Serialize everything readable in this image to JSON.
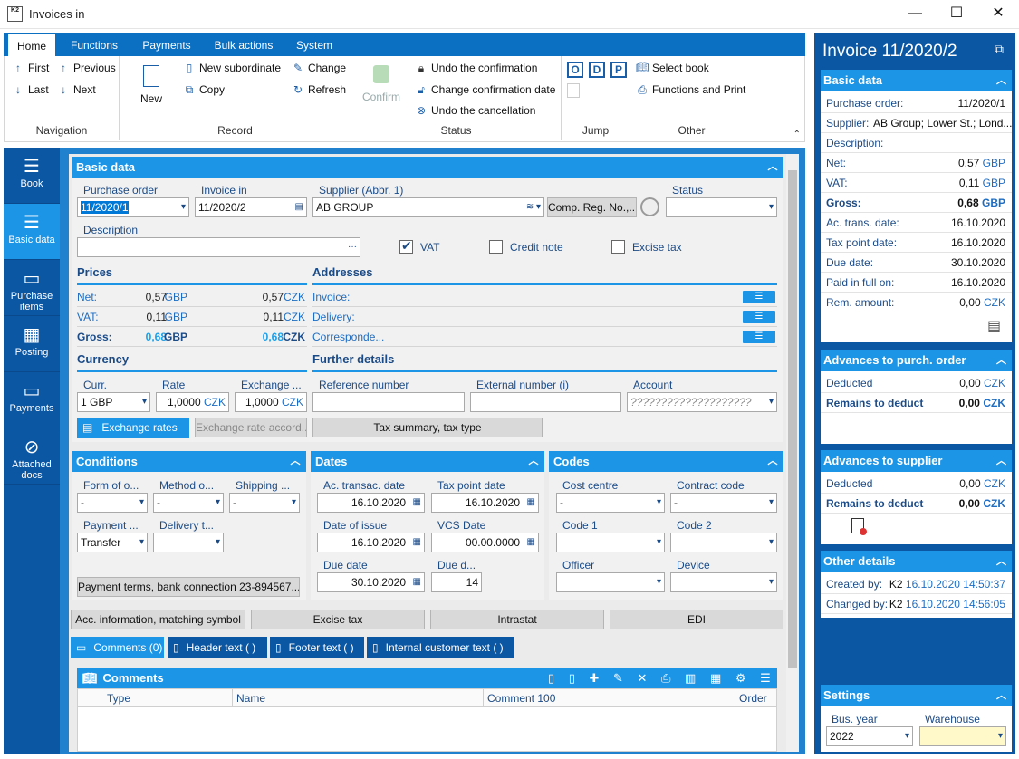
{
  "window": {
    "title": "Invoices in",
    "min": "—",
    "max": "☐",
    "close": "✕"
  },
  "ribbon": {
    "tabs": [
      "Home",
      "Functions",
      "Payments",
      "Bulk actions",
      "System"
    ],
    "nav": {
      "first": "First",
      "previous": "Previous",
      "last": "Last",
      "next": "Next",
      "label": "Navigation"
    },
    "record": {
      "new": "New",
      "new_sub": "New subordinate",
      "change": "Change",
      "copy": "Copy",
      "refresh": "Refresh",
      "label": "Record"
    },
    "status": {
      "confirm": "Confirm",
      "undo_conf": "Undo the confirmation",
      "change_date": "Change confirmation date",
      "undo_cancel": "Undo the cancellation",
      "label": "Status"
    },
    "jump": {
      "o": "O",
      "d": "D",
      "p": "P",
      "label": "Jump"
    },
    "other": {
      "select_book": "Select book",
      "func_print": "Functions and Print",
      "label": "Other"
    }
  },
  "leftnav": [
    {
      "label": "Book",
      "icon": "☰"
    },
    {
      "label": "Basic data",
      "icon": "☰"
    },
    {
      "label": "Purchase items",
      "icon": "▭"
    },
    {
      "label": "Posting",
      "icon": "▦"
    },
    {
      "label": "Payments",
      "icon": "▭"
    },
    {
      "label": "Attached docs",
      "icon": "⊘"
    }
  ],
  "basic": {
    "title": "Basic data",
    "po_label": "Purchase order",
    "po": "11/2020/1",
    "inv_label": "Invoice in",
    "inv": "11/2020/2",
    "sup_label": "Supplier (Abbr. 1)",
    "sup": "AB GROUP",
    "comp_btn": "Comp. Reg. No.,...",
    "status_label": "Status",
    "status": "",
    "desc_label": "Description",
    "desc": "",
    "vat": "VAT",
    "credit": "Credit note",
    "excise": "Excise tax"
  },
  "prices": {
    "title": "Prices",
    "rows": [
      {
        "k": "Net:",
        "a": "0,57",
        "ac": "GBP",
        "b": "0,57",
        "bc": "CZK"
      },
      {
        "k": "VAT:",
        "a": "0,11",
        "ac": "GBP",
        "b": "0,11",
        "bc": "CZK"
      },
      {
        "k": "Gross:",
        "a": "0,68",
        "ac": "GBP",
        "b": "0,68",
        "bc": "CZK"
      }
    ]
  },
  "addresses": {
    "title": "Addresses",
    "rows": [
      "Invoice:",
      "Delivery:",
      "Corresponde..."
    ]
  },
  "currency": {
    "title": "Currency",
    "curr_label": "Curr.",
    "curr": "1 GBP",
    "rate_label": "Rate",
    "rate": "1,0000",
    "rate_c": "CZK",
    "exch_label": "Exchange ...",
    "exch": "1,0000",
    "exch_c": "CZK",
    "btn_rates": "Exchange rates",
    "btn_accord": "Exchange rate accord..."
  },
  "further": {
    "title": "Further details",
    "ref_label": "Reference number",
    "ext_label": "External number (i)",
    "acc_label": "Account",
    "acc": "????????????????????",
    "btn_tax": "Tax summary, tax type"
  },
  "conditions": {
    "title": "Conditions",
    "form_label": "Form of o...",
    "form": "-",
    "method_label": "Method o...",
    "method": "-",
    "ship_label": "Shipping ...",
    "ship": "-",
    "pay_label": "Payment ...",
    "pay": "Transfer",
    "deliv_label": "Delivery t...",
    "deliv": "",
    "terms_btn": "Payment terms, bank connection 23-894567..."
  },
  "dates": {
    "title": "Dates",
    "act_label": "Ac. transac. date",
    "act": "16.10.2020",
    "tax_label": "Tax point date",
    "tax": "16.10.2020",
    "issue_label": "Date of issue",
    "issue": "16.10.2020",
    "vcs_label": "VCS Date",
    "vcs": "00.00.0000",
    "due_label": "Due date",
    "due": "30.10.2020",
    "dued_label": "Due d...",
    "dued": "14"
  },
  "codes": {
    "title": "Codes",
    "cc_label": "Cost centre",
    "cc": "-",
    "contract_label": "Contract code",
    "contract": "-",
    "c1_label": "Code 1",
    "c2_label": "Code 2",
    "officer_label": "Officer",
    "device_label": "Device"
  },
  "bottom_btns": [
    "Acc. information, matching symbol",
    "Excise tax",
    "Intrastat",
    "EDI"
  ],
  "tabs2": [
    "Comments (0)",
    "Header text ( )",
    "Footer text ( )",
    "Internal customer text ( )"
  ],
  "comments": {
    "title": "Comments",
    "cols": [
      "Type",
      "Name",
      "Comment 100",
      "Order"
    ]
  },
  "right": {
    "title": "Invoice 11/2020/2",
    "basic_title": "Basic data",
    "basic": [
      {
        "k": "Purchase order:",
        "v": "11/2020/1",
        "c": ""
      },
      {
        "k": "Supplier:",
        "v": "AB Group; Lower St.; Lond...",
        "c": ""
      },
      {
        "k": "Description:",
        "v": "",
        "c": ""
      },
      {
        "k": "Net:",
        "v": "0,57",
        "c": "GBP"
      },
      {
        "k": "VAT:",
        "v": "0,11",
        "c": "GBP"
      },
      {
        "k": "Gross:",
        "v": "0,68",
        "c": "GBP"
      },
      {
        "k": "Ac. trans. date:",
        "v": "16.10.2020",
        "c": ""
      },
      {
        "k": "Tax point date:",
        "v": "16.10.2020",
        "c": ""
      },
      {
        "k": "Due date:",
        "v": "30.10.2020",
        "c": ""
      },
      {
        "k": "Paid in full on:",
        "v": "16.10.2020",
        "c": ""
      },
      {
        "k": "Rem. amount:",
        "v": "0,00",
        "c": "CZK"
      }
    ],
    "adv_po_title": "Advances to purch. order",
    "adv_po": [
      {
        "k": "Deducted",
        "v": "0,00",
        "c": "CZK"
      },
      {
        "k": "Remains to deduct",
        "v": "0,00",
        "c": "CZK"
      }
    ],
    "adv_sup_title": "Advances to supplier",
    "adv_sup": [
      {
        "k": "Deducted",
        "v": "0,00",
        "c": "CZK"
      },
      {
        "k": "Remains to deduct",
        "v": "0,00",
        "c": "CZK"
      }
    ],
    "other_title": "Other details",
    "other": [
      {
        "k": "Created by:",
        "u": "K2",
        "v": "16.10.2020 14:50:37"
      },
      {
        "k": "Changed by:",
        "u": "K2",
        "v": "16.10.2020 14:56:05"
      }
    ],
    "settings_title": "Settings",
    "bus_label": "Bus. year",
    "bus": "2022",
    "wh_label": "Warehouse",
    "wh": ""
  }
}
